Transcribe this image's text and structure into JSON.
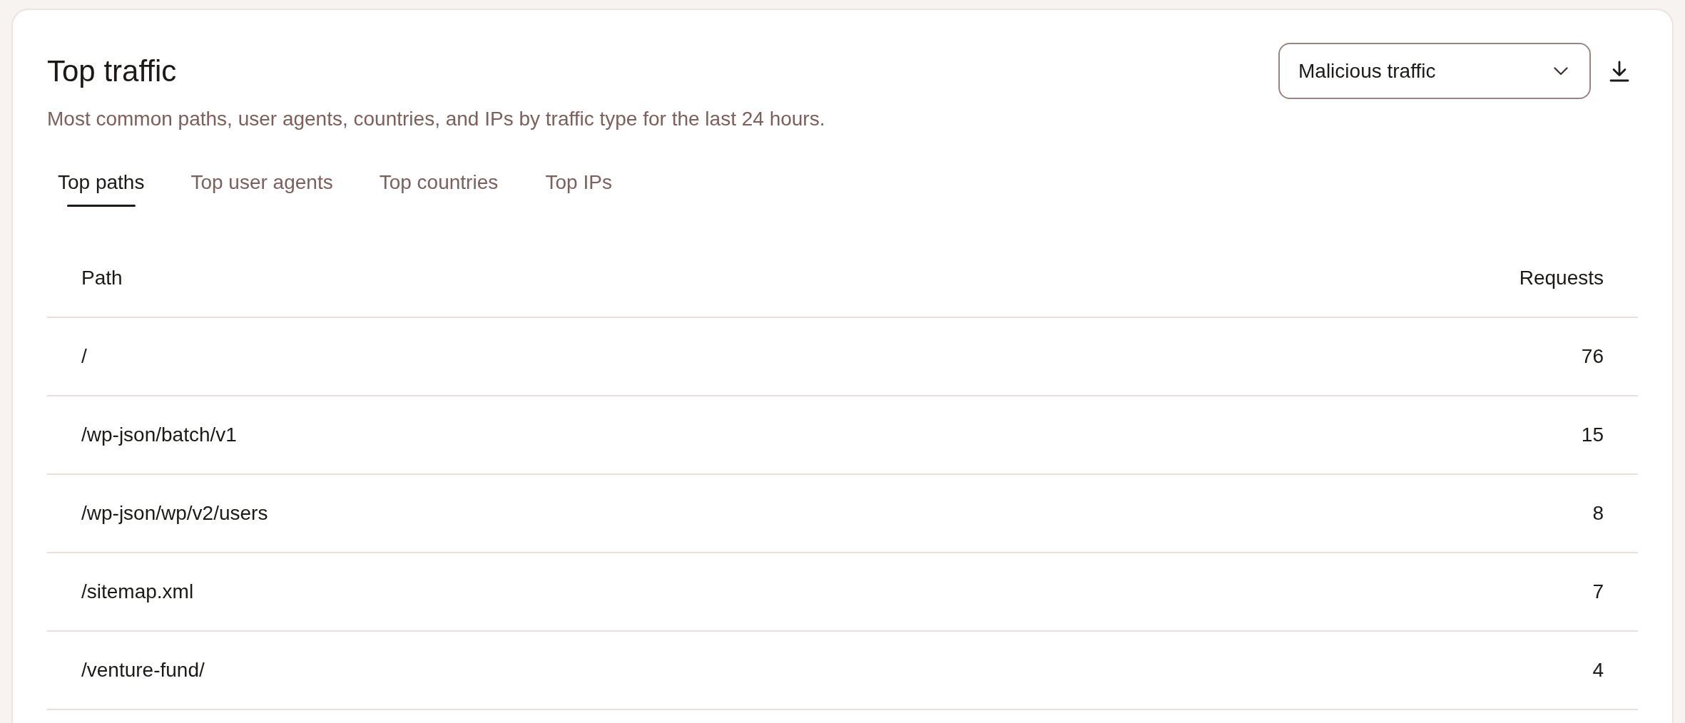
{
  "header": {
    "title": "Top traffic",
    "description": "Most common paths, user agents, countries, and IPs by traffic type for the last 24 hours."
  },
  "traffic_select": {
    "value": "Malicious traffic"
  },
  "tabs": [
    {
      "label": "Top paths",
      "selected": true
    },
    {
      "label": "Top user agents",
      "selected": false
    },
    {
      "label": "Top countries",
      "selected": false
    },
    {
      "label": "Top IPs",
      "selected": false
    }
  ],
  "table": {
    "columns": [
      "Path",
      "Requests"
    ],
    "rows": [
      {
        "path": "/",
        "requests": "76"
      },
      {
        "path": "/wp-json/batch/v1",
        "requests": "15"
      },
      {
        "path": "/wp-json/wp/v2/users",
        "requests": "8"
      },
      {
        "path": "/sitemap.xml",
        "requests": "7"
      },
      {
        "path": "/venture-fund/",
        "requests": "4"
      }
    ]
  }
}
